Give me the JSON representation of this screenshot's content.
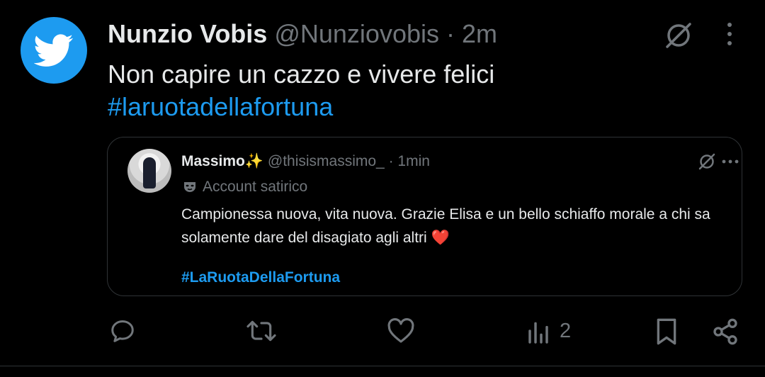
{
  "tweet": {
    "author_name": "Nunzio Vobis",
    "handle": "@Nunziovobis",
    "separator": "·",
    "time": "2m",
    "text": "Non capire un cazzo e vivere felici",
    "hashtag": "#laruotadellafortuna"
  },
  "quote": {
    "author_name": "Massimo",
    "sparkle": "✨",
    "handle": "@thisismassimo_",
    "separator": "·",
    "time": "1min",
    "label": "Account satirico",
    "text": "Campionessa nuova, vita nuova. Grazie Elisa e un bello schiaffo morale a chi sa solamente dare del disagiato agli altri",
    "heart": "❤️",
    "hashtag": "#LaRuotaDellaFortuna"
  },
  "actions": {
    "views_count": "2"
  },
  "icons": [
    "twitter-bird-icon",
    "grok-icon",
    "more-vertical-icon",
    "more-horizontal-icon",
    "mask-icon",
    "reply-icon",
    "retweet-icon",
    "like-icon",
    "views-icon",
    "bookmark-icon",
    "share-icon"
  ],
  "colors": {
    "background": "#000000",
    "text": "#e7e9ea",
    "muted": "#71767b",
    "accent": "#1d9bf0",
    "border": "#2f3336"
  }
}
